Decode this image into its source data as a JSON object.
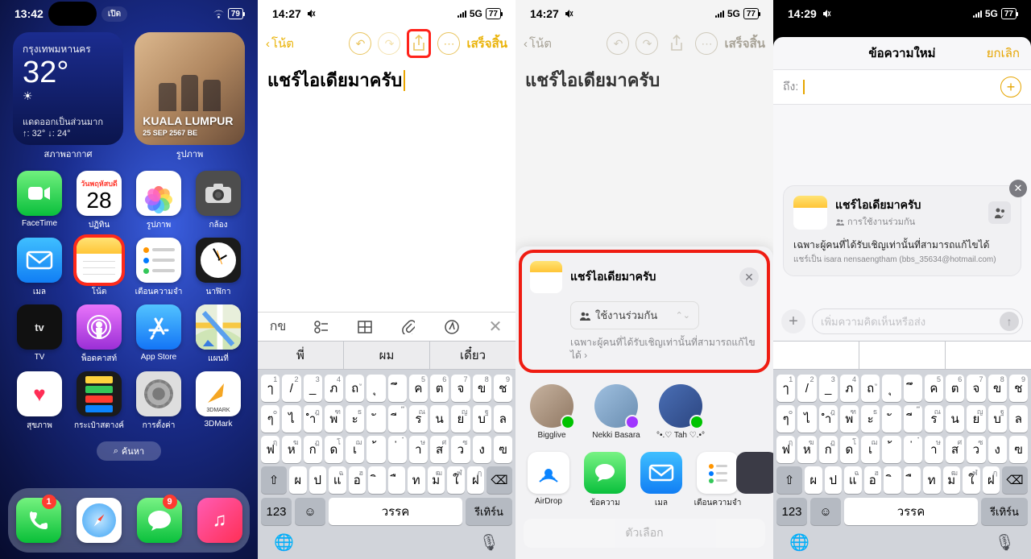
{
  "s1": {
    "status": {
      "time": "13:42",
      "island_label": "เปิด",
      "net": "",
      "wifi": true,
      "batt": "79"
    },
    "weather": {
      "city": "กรุงเทพมหานคร",
      "temp": "32°",
      "icon": "☀︎",
      "desc": "แดดออกเป็นส่วนมาก",
      "hilo": "↑: 32° ↓: 24°"
    },
    "photos_widget": {
      "title": "KUALA LUMPUR",
      "date": "25 SEP 2567 BE"
    },
    "widget_labels": {
      "w1": "สภาพอากาศ",
      "w2": "รูปภาพ"
    },
    "apps": {
      "facetime": "FaceTime",
      "calendar": "ปฏิทิน",
      "cal_weekday": "วันพฤหัสบดี",
      "cal_day": "28",
      "photos": "รูปภาพ",
      "camera": "กล้อง",
      "mail": "เมล",
      "notes": "โน้ต",
      "reminders": "เตือนความจำ",
      "clock": "นาฬิกา",
      "tv": "TV",
      "tv_logo": "tv",
      "podcasts": "พ็อดคาสท์",
      "appstore": "App Store",
      "maps": "แผนที่",
      "health": "สุขภาพ",
      "wallet": "กระเป๋าสตางค์",
      "settings": "การตั้งค่า",
      "threed": "3DMark",
      "threed_sub": "3DMARK"
    },
    "search": "ค้นหา",
    "dock_badges": {
      "phone": "1",
      "messages": "9"
    }
  },
  "s2": {
    "status": {
      "time": "14:27",
      "net": "5G",
      "batt": "77"
    },
    "back": "โน้ต",
    "done": "เสร็จสิ้น",
    "title": "แชร์ไอเดียมาครับ",
    "fmt": {
      "aa": "กข"
    },
    "sugg": {
      "a": "พี่",
      "b": "ผม",
      "c": "เดี๋ยว"
    },
    "kb": {
      "num": "123",
      "space": "วรรค",
      "ret": "รีเทิร์น"
    }
  },
  "s3": {
    "status": {
      "time": "14:27",
      "net": "5G",
      "batt": "77"
    },
    "back": "โน้ต",
    "done": "เสร็จสิ้น",
    "title": "แชร์ไอเดียมาครับ",
    "sheet": {
      "title": "แชร์ไอเดียมาครับ",
      "collab": "ใช้งานร่วมกัน",
      "note": "เฉพาะผู้คนที่ได้รับเชิญเท่านั้นที่สามารถแก้ไขได้ ›",
      "contacts": [
        {
          "name": "Bigglive",
          "badge": "#00c300"
        },
        {
          "name": "Nekki Basara",
          "badge": "#a036ff"
        },
        {
          "name": "°•.♡ Tah ♡.•°",
          "badge": "#00c300"
        }
      ],
      "apps": {
        "airdrop": "AirDrop",
        "messages": "ข้อความ",
        "mail": "เมล",
        "reminders": "เตือนความจำ"
      },
      "more": "ตัวเลือก"
    }
  },
  "s4": {
    "status": {
      "time": "14:29",
      "net": "5G",
      "batt": "77"
    },
    "hdr": {
      "title": "ข้อความใหม่",
      "cancel": "ยกเลิก"
    },
    "to": "ถึง:",
    "card": {
      "title": "แชร์ไอเดียมาครับ",
      "sub": "การใช้งานร่วมกัน",
      "desc": "เฉพาะผู้คนที่ได้รับเชิญเท่านั้นที่สามารถแก้ไขได้",
      "from": "แชร์เป็น isara nensaengtham (bbs_35634@hotmail.com)"
    },
    "compose_ph": "เพิ่มความคิดเห็นหรือส่ง",
    "sugg": {
      "a": "",
      "b": "",
      "c": ""
    },
    "kb": {
      "num": "123",
      "space": "วรรค",
      "ret": "รีเทิร์น"
    }
  },
  "thai_rows": [
    [
      [
        "ๅ",
        "1"
      ],
      [
        "/",
        "2"
      ],
      [
        "_",
        "3"
      ],
      [
        "ภ",
        "4"
      ],
      [
        "ถ",
        "ู"
      ],
      [
        "ุ",
        ""
      ],
      [
        "ึ",
        ""
      ],
      [
        "ค",
        "5"
      ],
      [
        "ต",
        "6"
      ],
      [
        "จ",
        "7"
      ],
      [
        "ข",
        "8"
      ],
      [
        "ช",
        "9"
      ]
    ],
    [
      [
        "ๆ",
        "๐"
      ],
      [
        "ไ",
        ""
      ],
      [
        "ำ",
        "ฎ"
      ],
      [
        "พ",
        "ฑ"
      ],
      [
        "ะ",
        "ธ"
      ],
      [
        "ั",
        ""
      ],
      [
        "ี",
        "๊"
      ],
      [
        "ร",
        "ณ"
      ],
      [
        "น",
        ""
      ],
      [
        "ย",
        "ญ"
      ],
      [
        "บ",
        "ฐ"
      ],
      [
        "ล",
        ""
      ]
    ],
    [
      [
        "ฟ",
        "ฤ"
      ],
      [
        "ห",
        "ฆ"
      ],
      [
        "ก",
        "ฏ"
      ],
      [
        "ด",
        "โ"
      ],
      [
        "เ",
        "ฌ"
      ],
      [
        "้",
        ""
      ],
      [
        "่",
        "๋"
      ],
      [
        "า",
        "ษ"
      ],
      [
        "ส",
        "ศ"
      ],
      [
        "ว",
        "ซ"
      ],
      [
        "ง",
        ""
      ],
      [
        "ฃ",
        ""
      ]
    ],
    [
      [
        "ผ",
        ""
      ],
      [
        "ป",
        ""
      ],
      [
        "แ",
        "ฉ"
      ],
      [
        "อ",
        "ฮ"
      ],
      [
        "ิ",
        ""
      ],
      [
        "ื",
        ""
      ],
      [
        "ท",
        ""
      ],
      [
        "ม",
        "ฒ"
      ],
      [
        "ใ",
        "ฬ"
      ],
      [
        "ฝ",
        "ฦ"
      ]
    ]
  ]
}
